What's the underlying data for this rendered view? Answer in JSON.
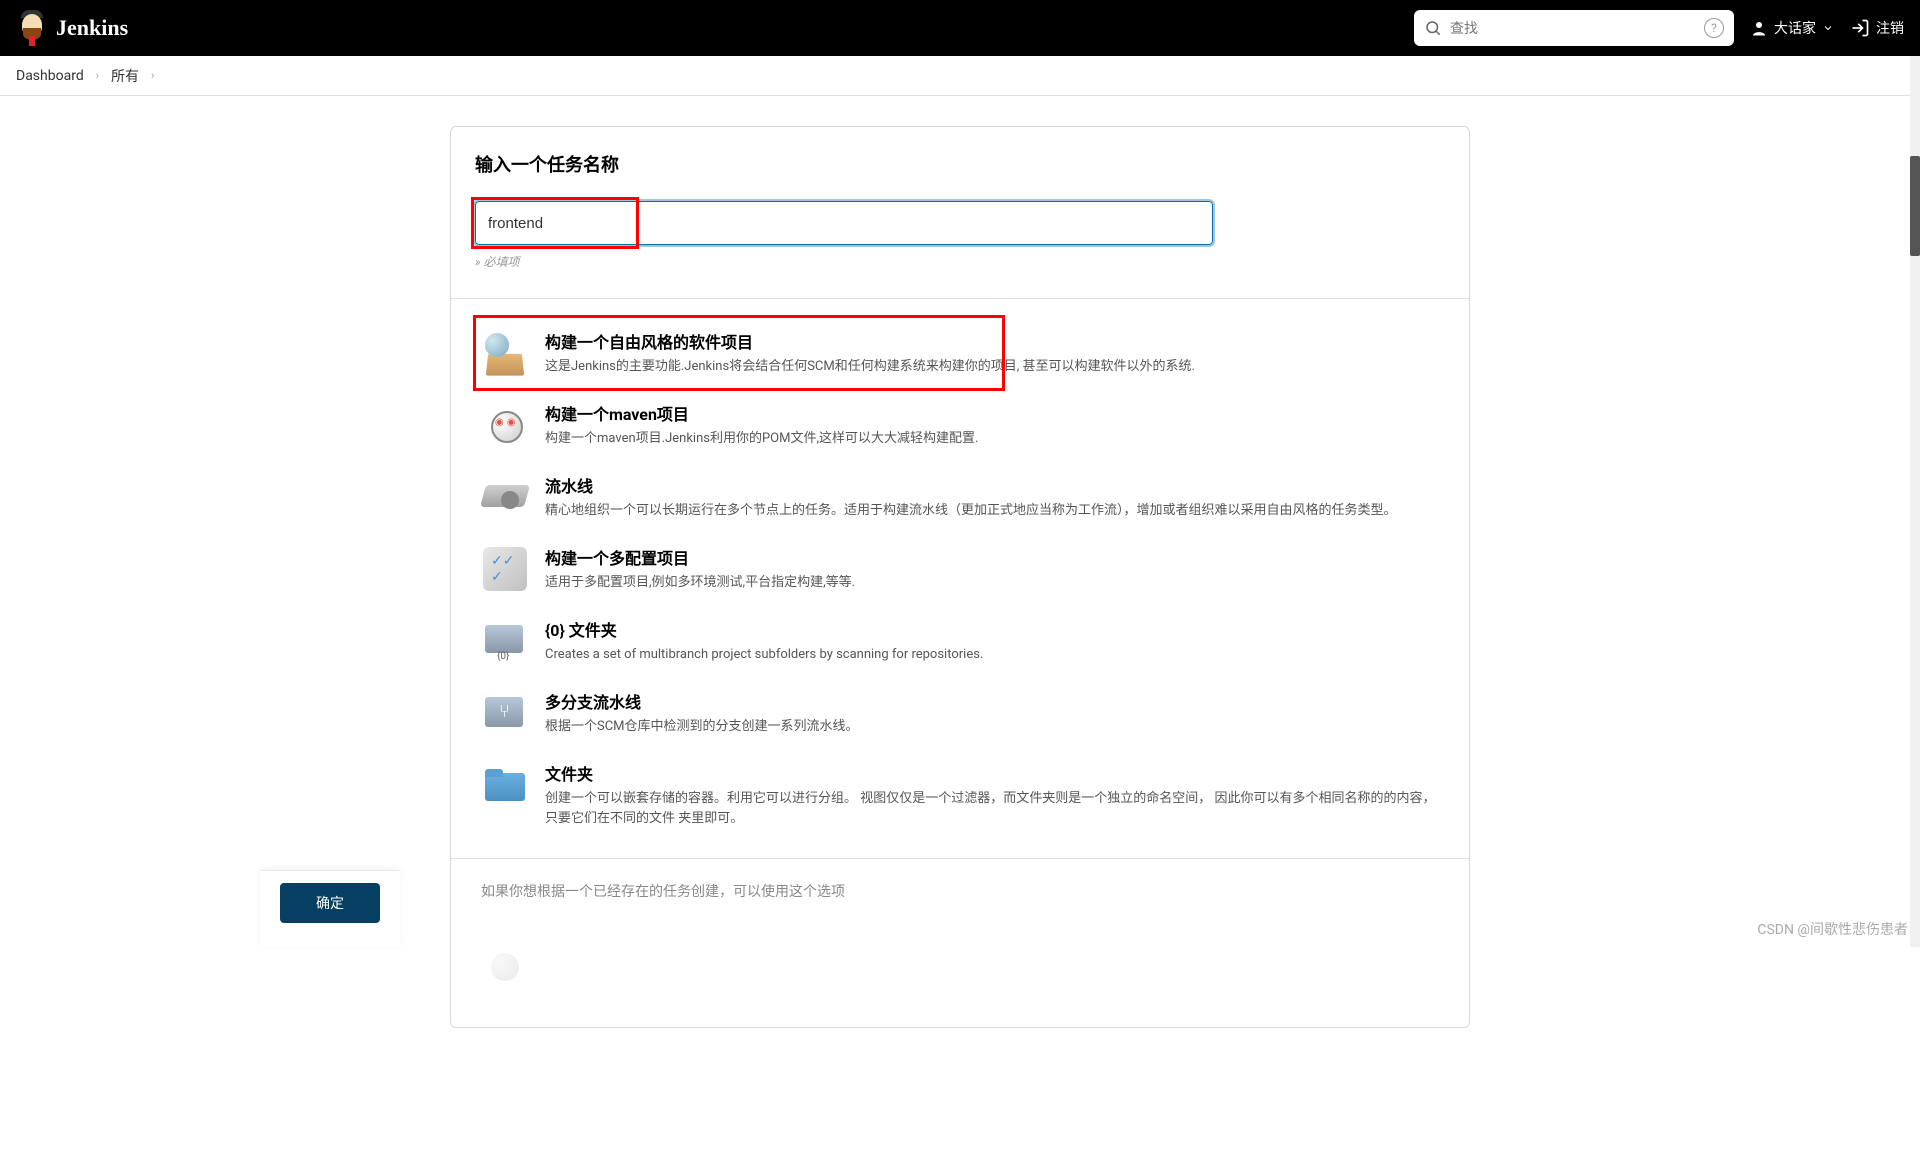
{
  "header": {
    "title": "Jenkins",
    "search": {
      "placeholder": "查找"
    },
    "user": "大话家",
    "logout": "注销"
  },
  "breadcrumbs": {
    "items": [
      "Dashboard",
      "所有"
    ]
  },
  "main": {
    "section_title": "输入一个任务名称",
    "input_value": "frontend",
    "required_note": "» 必填项",
    "job_types": [
      {
        "title": "构建一个自由风格的软件项目",
        "desc": "这是Jenkins的主要功能.Jenkins将会结合任何SCM和任何构建系统来构建你的项目, 甚至可以构建软件以外的系统."
      },
      {
        "title": "构建一个maven项目",
        "desc": "构建一个maven项目.Jenkins利用你的POM文件,这样可以大大减轻构建配置."
      },
      {
        "title": "流水线",
        "desc": "精心地组织一个可以长期运行在多个节点上的任务。适用于构建流水线（更加正式地应当称为工作流），增加或者组织难以采用自由风格的任务类型。"
      },
      {
        "title": "构建一个多配置项目",
        "desc": "适用于多配置项目,例如多环境测试,平台指定构建,等等."
      },
      {
        "title": "{0} 文件夹",
        "desc": "Creates a set of multibranch project subfolders by scanning for repositories."
      },
      {
        "title": "多分支流水线",
        "desc": "根据一个SCM仓库中检测到的分支创建一系列流水线。"
      },
      {
        "title": "文件夹",
        "desc": "创建一个可以嵌套存储的容器。利用它可以进行分组。 视图仅仅是一个过滤器，而文件夹则是一个独立的命名空间， 因此你可以有多个相同名称的的内容，只要它们在不同的文件 夹里即可。"
      }
    ],
    "copy_text": "如果你想根据一个已经存在的任务创建，可以使用这个选项"
  },
  "footer": {
    "ok_button": "确定"
  },
  "watermark": "CSDN @间歇性悲伤患者"
}
